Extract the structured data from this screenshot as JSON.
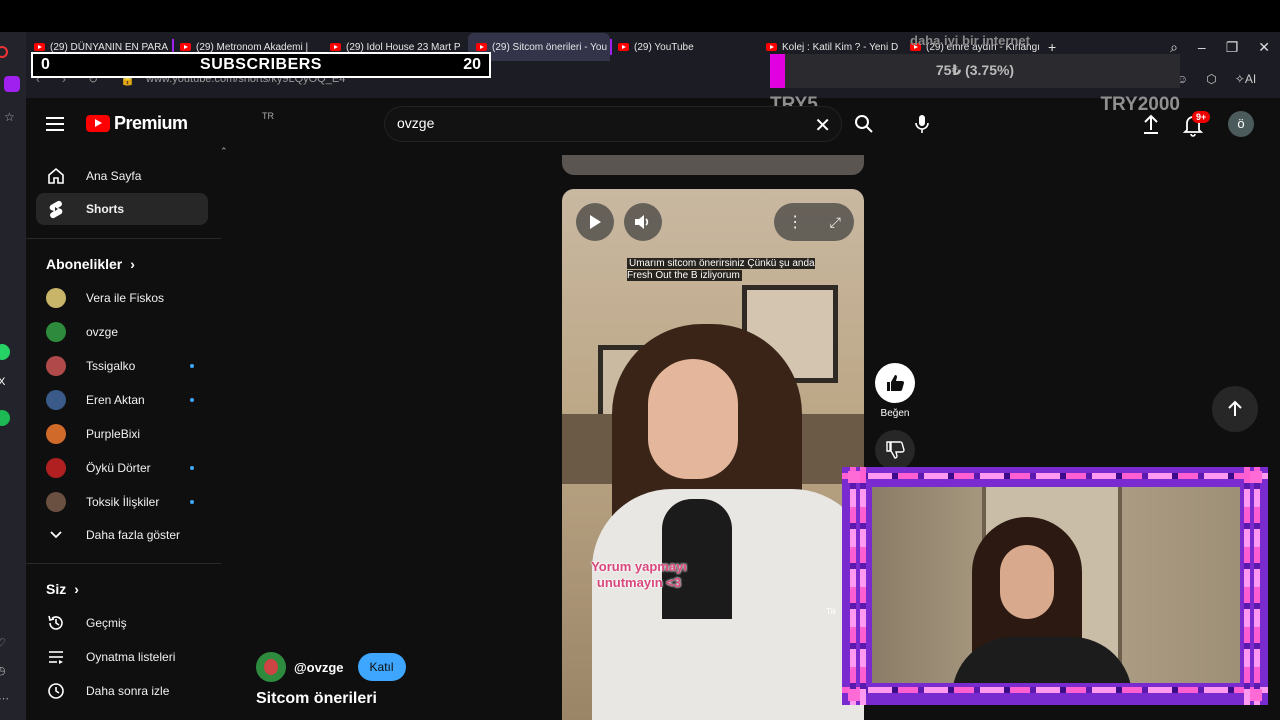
{
  "browser": {
    "tabs": [
      {
        "label": "(29) DÜNYANIN EN PARA",
        "active": false
      },
      {
        "label": "(29) Metronom Akademi |",
        "active": false
      },
      {
        "label": "(29) Idol House 23 Mart P",
        "active": false
      },
      {
        "label": "(29) Sitcom önerileri - You",
        "active": true
      },
      {
        "label": "(29) YouTube",
        "active": false
      },
      {
        "label": "Kolej : Katil Kim ? - Yeni D",
        "active": false
      },
      {
        "label": "(29) emre aydın - Kırlangıç",
        "active": false
      }
    ],
    "new_tab": "+",
    "url": "www.youtube.com/shorts/ky9LQyOQ_E4",
    "ai_label": "AI"
  },
  "overlay": {
    "subs_left": "0",
    "subs_title": "SUBSCRIBERS",
    "subs_right": "20",
    "donation_faint": "daha iyi bir internet",
    "donation_amount": "75₺ (3.75%)",
    "donation_progress": 0.0375,
    "donation_low": "TRY5",
    "donation_high": "TRY2000",
    "accent": "#e000e0"
  },
  "youtube": {
    "logo": "Premium",
    "logo_region": "TR",
    "search_value": "ovzge",
    "notif_badge": "9+",
    "avatar_letter": "ö",
    "sidebar": {
      "home": "Ana Sayfa",
      "shorts": "Shorts",
      "subs_header": "Abonelikler",
      "subs": [
        {
          "name": "Vera ile Fiskos",
          "color": "#c9b56a",
          "dot": false
        },
        {
          "name": "ovzge",
          "color": "#2e8b3e",
          "dot": false
        },
        {
          "name": "Tssigalko",
          "color": "#b04a4a",
          "dot": true
        },
        {
          "name": "Eren Aktan",
          "color": "#3a5a8a",
          "dot": true
        },
        {
          "name": "PurpleBixi",
          "color": "#d06a2a",
          "dot": false
        },
        {
          "name": "Öykü Dörter",
          "color": "#b02020",
          "dot": true
        },
        {
          "name": "Toksik İlişkiler",
          "color": "#6a5040",
          "dot": true
        }
      ],
      "show_more": "Daha fazla göster",
      "you_header": "Siz",
      "history": "Geçmiş",
      "playlists": "Oynatma listeleri",
      "watch_later": "Daha sonra izle"
    },
    "short": {
      "caption": "Umarım sitcom önerirsiniz Çünkü şu anda Fresh Out the B izliyorum",
      "overlay_text": "Yorum yapmayı unutmayın <3",
      "tiktok": "Tik",
      "channel": "@ovzge",
      "join": "Katıl",
      "title": "Sitcom önerileri",
      "like_label": "Beğen"
    }
  }
}
